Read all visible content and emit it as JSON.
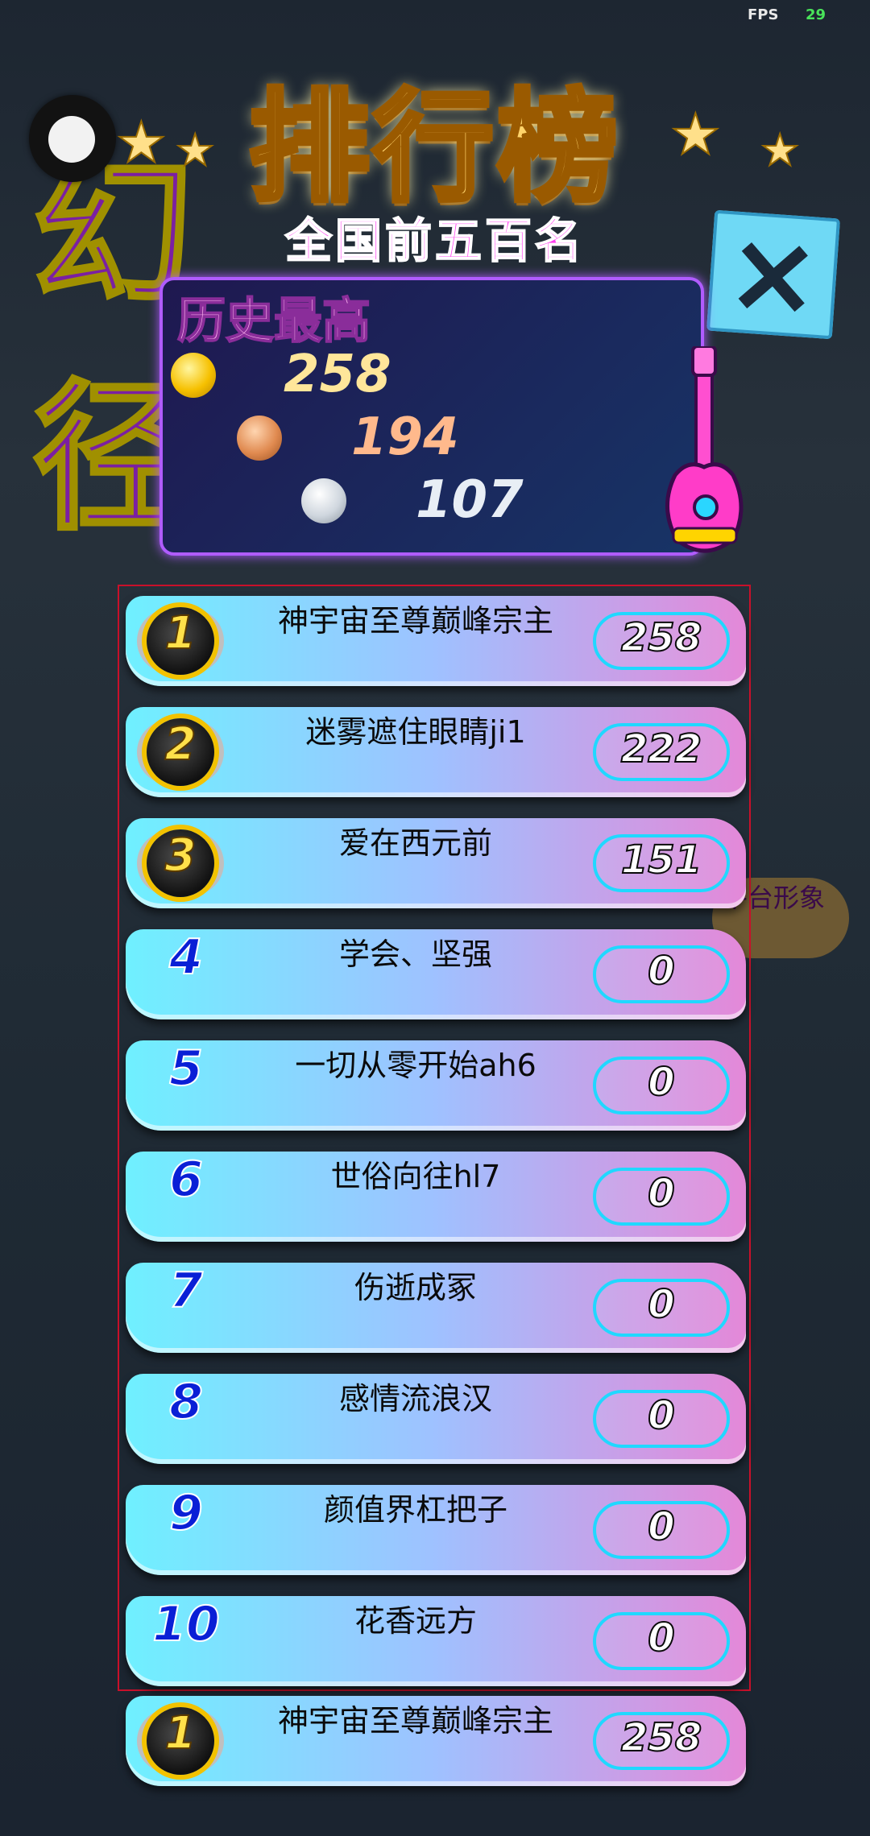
{
  "hud": {
    "fps_label": "FPS",
    "fps_value": "29"
  },
  "background": {
    "glyph_1": "幻",
    "glyph_2": "径",
    "side_button_label": "平台形象"
  },
  "header": {
    "title": "排行榜",
    "subtitle": "全国前五百名"
  },
  "history": {
    "title": "历史最高",
    "gold": "258",
    "bronze": "194",
    "silver": "107"
  },
  "leaderboard": {
    "rows": [
      {
        "rank": "1",
        "name": "神宇宙至尊巅峰宗主",
        "score": "258"
      },
      {
        "rank": "2",
        "name": "迷雾遮住眼睛ji1",
        "score": "222"
      },
      {
        "rank": "3",
        "name": "爱在西元前",
        "score": "151"
      },
      {
        "rank": "4",
        "name": "学会、坚强",
        "score": "0"
      },
      {
        "rank": "5",
        "name": "一切从零开始ah6",
        "score": "0"
      },
      {
        "rank": "6",
        "name": "世俗向往hl7",
        "score": "0"
      },
      {
        "rank": "7",
        "name": "伤逝成冢",
        "score": "0"
      },
      {
        "rank": "8",
        "name": "感情流浪汉",
        "score": "0"
      },
      {
        "rank": "9",
        "name": "颜值界杠把子",
        "score": "0"
      },
      {
        "rank": "10",
        "name": "花香远方",
        "score": "0"
      }
    ],
    "self": {
      "rank": "1",
      "name": "神宇宙至尊巅峰宗主",
      "score": "258"
    }
  }
}
